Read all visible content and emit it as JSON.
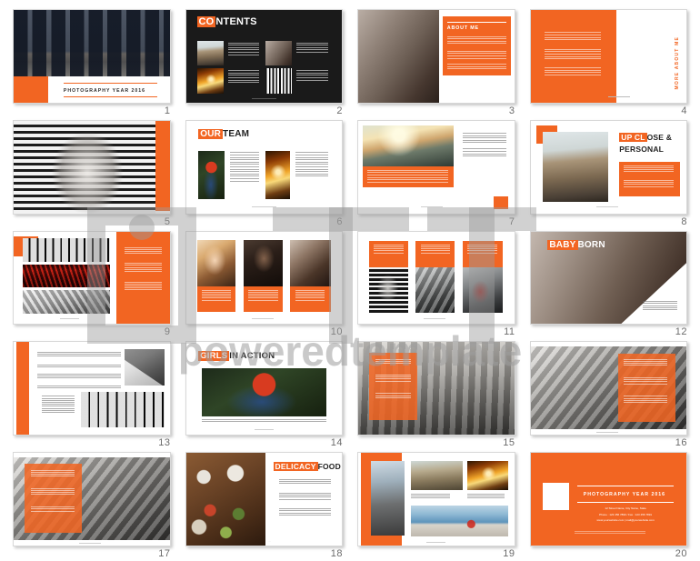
{
  "document": {
    "theme_color": "#f26522",
    "slide_count": 20,
    "watermark": "poweredtemplate"
  },
  "slides": [
    {
      "n": "1",
      "title": "PHOTOGRAPHY  YEAR  2016",
      "layout": "cover-photo-top",
      "type": "title"
    },
    {
      "n": "2",
      "title": "CONTENTS",
      "title_hl": "CO",
      "title_rest": "NTENTS",
      "layout": "dark-contents",
      "type": "contents"
    },
    {
      "n": "3",
      "title": "ABOUT  ME",
      "layout": "photo-left-orange-panel-right",
      "type": "about"
    },
    {
      "n": "4",
      "title": "MORE ABOUT ME",
      "layout": "orange-left-text-vertical-title-right",
      "type": "about-more"
    },
    {
      "n": "5",
      "title": "",
      "layout": "full-photo-orange-bar-right",
      "type": "image"
    },
    {
      "n": "6",
      "title": "OUR TEAM",
      "title_hl": "OUR",
      "title_rest": "TEAM",
      "layout": "two-column-photo-text",
      "type": "team"
    },
    {
      "n": "7",
      "title": "",
      "layout": "photo-top-orange-caption-text-right",
      "type": "feature"
    },
    {
      "n": "8",
      "title": "UP CLOSE & PERSONAL",
      "title_hl": "UP CL",
      "title_rest": "OSE &",
      "title_line2": "PERSONAL",
      "layout": "photo-left-title-orange-box-right",
      "type": "feature"
    },
    {
      "n": "9",
      "title": "",
      "layout": "three-stacked-photos-orange-panel",
      "type": "gallery"
    },
    {
      "n": "10",
      "title": "",
      "layout": "three-portraits-orange-captions",
      "type": "gallery"
    },
    {
      "n": "11",
      "title": "",
      "layout": "three-orange-captions-over-photos",
      "type": "gallery"
    },
    {
      "n": "12",
      "title": "BABY BORN",
      "title_hl": "BABY",
      "title_rest": "BORN",
      "layout": "full-bleed-photo-diagonal",
      "type": "feature"
    },
    {
      "n": "13",
      "title": "",
      "layout": "orange-bar-left-text-two-photos",
      "type": "article"
    },
    {
      "n": "14",
      "title": "GIRLS IN ACTION",
      "title_hl": "GIRLS",
      "title_rest": "IN ACTION",
      "layout": "title-big-photo-caption",
      "type": "feature"
    },
    {
      "n": "15",
      "title": "",
      "layout": "full-photo-orange-overlay-left",
      "type": "feature"
    },
    {
      "n": "16",
      "title": "",
      "layout": "photo-orange-translucent-right",
      "type": "feature"
    },
    {
      "n": "17",
      "title": "",
      "layout": "photo-orange-translucent-left",
      "type": "feature"
    },
    {
      "n": "18",
      "title": "DELICACY FOOD",
      "title_hl": "DELICACY",
      "title_rest": "FOOD",
      "layout": "photo-left-title-text-right",
      "type": "feature"
    },
    {
      "n": "19",
      "title": "",
      "layout": "orange-bar-left-photo-grid",
      "type": "gallery"
    },
    {
      "n": "20",
      "title": "PHOTOGRAPHY  YEAR  2016",
      "contact_line_1": "12 Street Name, City Name, State",
      "contact_line_2": "Phone : 123 456 7890  /  Fax : 123 456 7891",
      "contact_line_3": "www.yourwebsite.com   |   mail@yourwebsite.com",
      "layout": "orange-closing",
      "type": "closing"
    }
  ]
}
